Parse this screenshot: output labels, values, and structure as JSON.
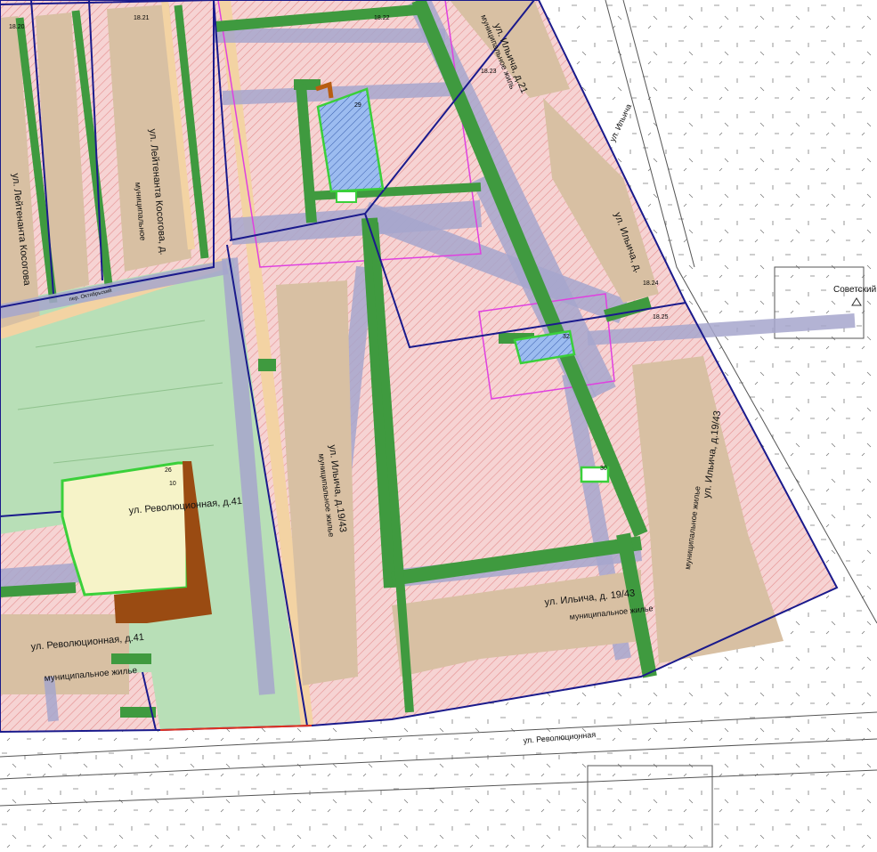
{
  "map": {
    "colors": {
      "zone_fill": "#f6d3d3",
      "zone_hatch": "#e58f8f",
      "building": "#d8c0a3",
      "road_strip": "#f3d3a3",
      "green_strip": "#3f9a3f",
      "passage": "#a6a6cc",
      "park": "#b8dfb7",
      "boundary": "#1a1a8c",
      "magenta": "#e040e0",
      "highlight_building": "#f6f3c8",
      "brown_annex": "#9a4b12",
      "blue_plot": "#9cbcf0",
      "red_line": "#e03020"
    },
    "labels": {
      "street_ilyicha_top": "ул. Ильича, д.21",
      "municipal_top": "муниципальное жиль",
      "street_leit_kos": "ул. Лейтенанта Косогова, д.",
      "municipal_left": "муниципальное",
      "street_kosogova_v": "ул. Лейтенанта Косогова",
      "street_ilyicha_mid": "ул. Ильича, д.",
      "street_rev41_a": "ул. Революционная, д.41",
      "street_rev41_b": "ул. Революционная, д.41",
      "municipal_rev": "муниципальное жилье",
      "street_ilyicha_1943_v": "ул. Ильича, д.19/43",
      "municipal_v": "муниципальное жилье",
      "street_ilyicha_1943_h": "ул. Ильича, д. 19/43",
      "municipal_h": "муниципальное жилье",
      "street_ilyicha_1943_r": "ул. Ильича, д.19/43",
      "municipal_r": "муниципальное жилье",
      "revolutsionnaya": "ул. Революционная",
      "ilyicha_street": "ул. Ильича",
      "sovetsky": "Советский",
      "per_oktyabrsky": "пер. Октябрьский"
    },
    "zone_codes": {
      "z1820": "18.20",
      "z1821": "18.21",
      "z1822": "18.22",
      "z1823": "18.23",
      "z1824": "18.24",
      "z1825": "18.25"
    },
    "plot_numbers": {
      "p29": "29",
      "p32": "32",
      "p30": "30",
      "p26": "26",
      "p10": "10"
    }
  }
}
